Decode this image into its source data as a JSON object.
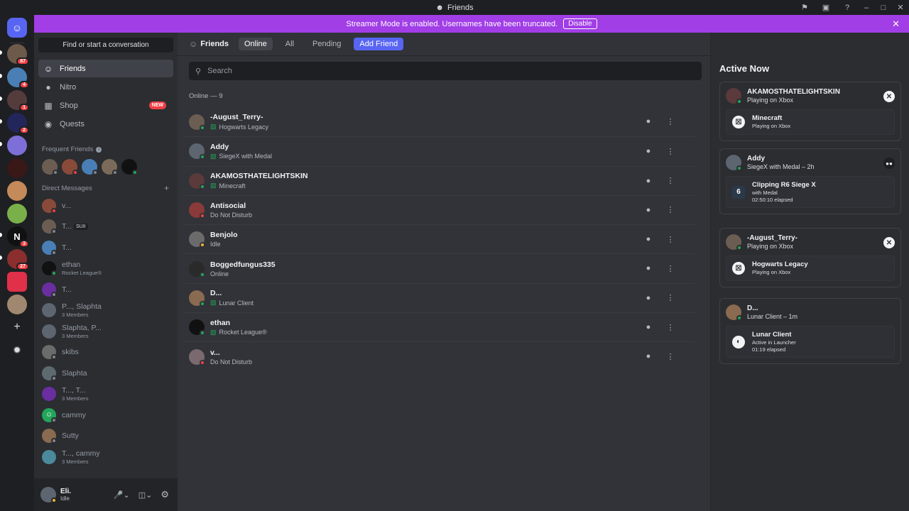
{
  "window": {
    "title": "Friends"
  },
  "banner": {
    "text": "Streamer Mode is enabled. Usernames have been truncated.",
    "disable_label": "Disable"
  },
  "guild_badges": [
    "87",
    "4",
    "1",
    "2",
    "3",
    "27"
  ],
  "sidebar": {
    "search_label": "Find or start a conversation",
    "nav": [
      {
        "label": "Friends",
        "icon": "friends-icon"
      },
      {
        "label": "Nitro",
        "icon": "nitro-icon"
      },
      {
        "label": "Shop",
        "icon": "shop-icon",
        "badge": "NEW"
      },
      {
        "label": "Quests",
        "icon": "quests-icon"
      }
    ],
    "frequent_friends_label": "Frequent Friends",
    "dm_header": "Direct Messages",
    "dms": [
      {
        "name": "v...",
        "sub": "",
        "tag": ""
      },
      {
        "name": "T...",
        "sub": "",
        "tag": "SUII"
      },
      {
        "name": "T...",
        "sub": "",
        "tag": ""
      },
      {
        "name": "ethan",
        "sub": "Rocket League®",
        "tag": ""
      },
      {
        "name": "T...",
        "sub": "",
        "tag": ""
      },
      {
        "name": "P..., Slaphta",
        "sub": "3 Members",
        "tag": ""
      },
      {
        "name": "Slaphta, P...",
        "sub": "3 Members",
        "tag": ""
      },
      {
        "name": "skibs",
        "sub": "",
        "tag": ""
      },
      {
        "name": "Slaphta",
        "sub": "",
        "tag": ""
      },
      {
        "name": "T..., T...",
        "sub": "3 Members",
        "tag": ""
      },
      {
        "name": "cammy",
        "sub": "",
        "tag": ""
      },
      {
        "name": "Sutty",
        "sub": "",
        "tag": ""
      },
      {
        "name": "T..., cammy",
        "sub": "3 Members",
        "tag": ""
      }
    ],
    "user": {
      "name": "Eli.",
      "status": "Idle"
    }
  },
  "main": {
    "title": "Friends",
    "tabs": [
      "Online",
      "All",
      "Pending"
    ],
    "add_friend_label": "Add Friend",
    "search_placeholder": "Search",
    "online_header": "Online — 9",
    "friends": [
      {
        "name": "-August_Terry-",
        "status": "Hogwarts Legacy",
        "game": true,
        "color": "#23a55a"
      },
      {
        "name": "Addy",
        "status": "SiegeX with Medal",
        "game": true,
        "color": "#23a55a"
      },
      {
        "name": "AKAMOSTHATELIGHTSKIN",
        "status": "Minecraft",
        "game": true,
        "color": "#23a55a"
      },
      {
        "name": "Antisocial",
        "status": "Do Not Disturb",
        "game": false,
        "color": "#f23f43"
      },
      {
        "name": "Benjolo",
        "status": "Idle",
        "game": false,
        "color": "#f0b232"
      },
      {
        "name": "Boggedfungus335",
        "status": "Online",
        "game": false,
        "color": "#23a55a"
      },
      {
        "name": "D...",
        "status": "Lunar Client",
        "game": true,
        "color": "#23a55a"
      },
      {
        "name": "ethan",
        "status": "Rocket League®",
        "game": true,
        "color": "#23a55a"
      },
      {
        "name": "v...",
        "status": "Do Not Disturb",
        "game": false,
        "color": "#f23f43"
      }
    ]
  },
  "active_now": {
    "title": "Active Now",
    "cards": [
      {
        "name": "AKAMOSTHATELIGHTSKIN",
        "status": "Playing on Xbox",
        "activity": "Minecraft",
        "detail1": "Playing on Xbox",
        "detail2": ""
      },
      {
        "name": "Addy",
        "status": "SiegeX with Medal – 2h",
        "activity": "Clipping R6 Siege X",
        "detail1": "with Medal",
        "detail2": "02:50:10 elapsed"
      },
      {
        "name": "-August_Terry-",
        "status": "Playing on Xbox",
        "activity": "Hogwarts Legacy",
        "detail1": "Playing on Xbox",
        "detail2": ""
      },
      {
        "name": "D...",
        "status": "Lunar Client – 1m",
        "activity": "Lunar Client",
        "detail1": "Active in Launcher",
        "detail2": "01:19 elapsed"
      }
    ]
  }
}
